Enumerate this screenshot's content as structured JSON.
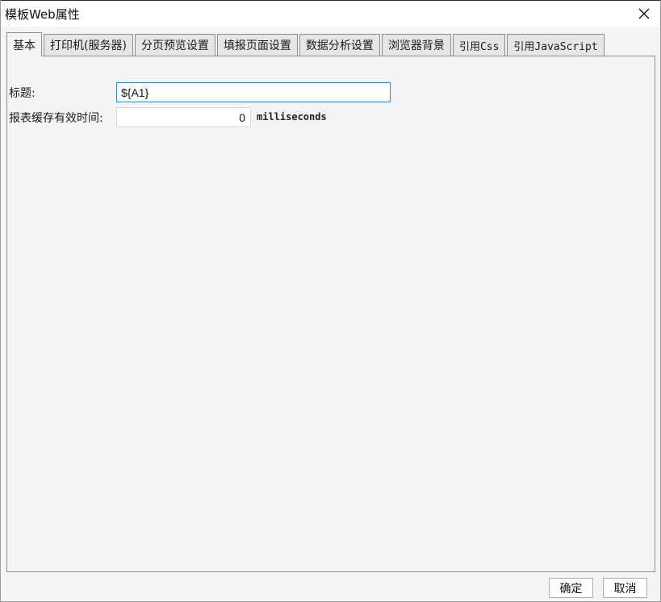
{
  "window": {
    "title": "模板Web属性"
  },
  "icons": {
    "close": "close-icon"
  },
  "tabs": [
    {
      "label": "基本",
      "active": true
    },
    {
      "label": "打印机(服务器)",
      "active": false
    },
    {
      "label": "分页预览设置",
      "active": false
    },
    {
      "label": "填报页面设置",
      "active": false
    },
    {
      "label": "数据分析设置",
      "active": false
    },
    {
      "label": "浏览器背景",
      "active": false
    },
    {
      "label": "引用Css",
      "active": false
    },
    {
      "label": "引用JavaScript",
      "active": false
    }
  ],
  "basic": {
    "title_label": "标题:",
    "title_value": "${A1}",
    "cache_label": "报表缓存有效时间:",
    "cache_value": "0",
    "cache_unit": "milliseconds"
  },
  "footer": {
    "ok_label": "确定",
    "cancel_label": "取消"
  },
  "colors": {
    "focus_border": "#3b84d8",
    "panel_bg": "#f4f4f6"
  }
}
